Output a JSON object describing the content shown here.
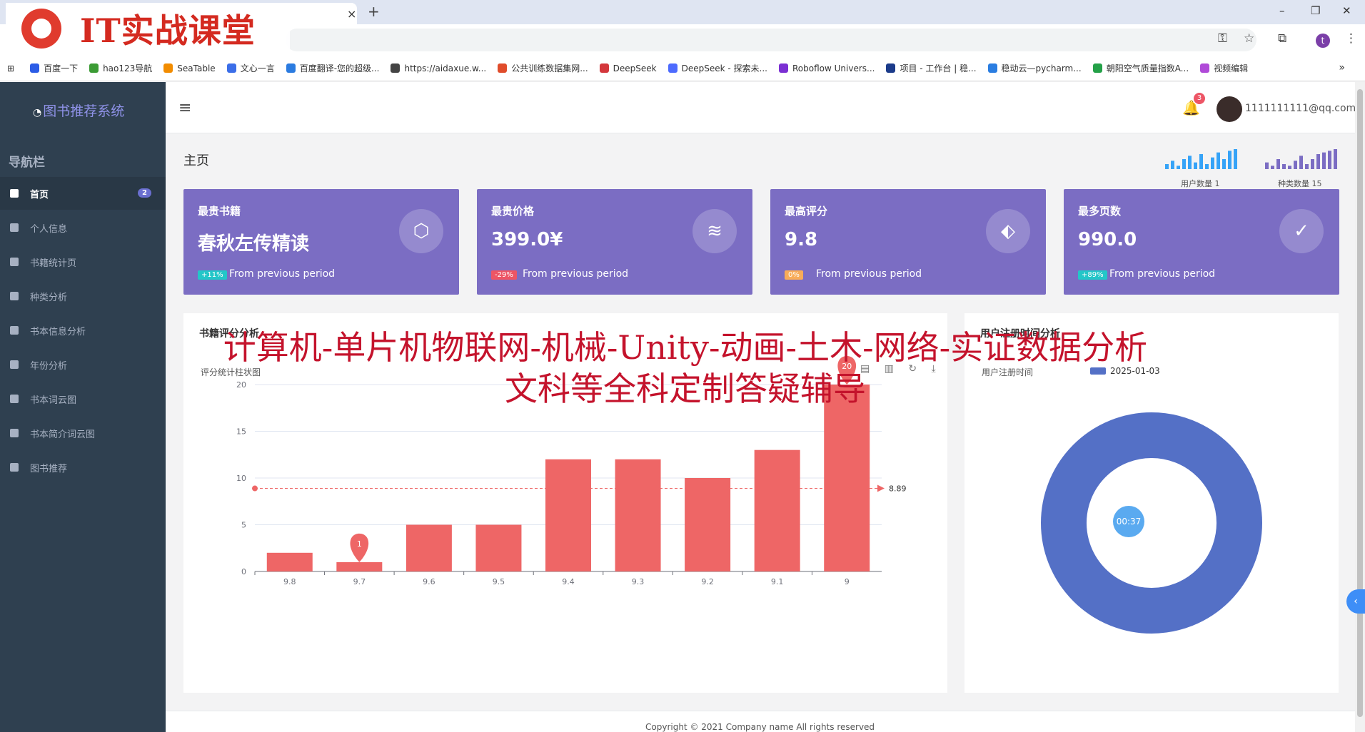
{
  "browser": {
    "tab_close": "×",
    "new_tab": "+",
    "window": {
      "minimize": "–",
      "restore": "❐",
      "close": "✕"
    },
    "profile_initial": "t",
    "bookmarks": [
      {
        "label": "百度一下",
        "color": "#2b5ce6"
      },
      {
        "label": "hao123导航",
        "color": "#3b9b34"
      },
      {
        "label": "SeaTable",
        "color": "#f28c00"
      },
      {
        "label": "文心一言",
        "color": "#3b6ee8"
      },
      {
        "label": "百度翻译-您的超级...",
        "color": "#2b7be0"
      },
      {
        "label": "https://aidaxue.w...",
        "color": "#444444"
      },
      {
        "label": "公共训练数据集网...",
        "color": "#e04c2b"
      },
      {
        "label": "DeepSeek",
        "color": "#d4373c"
      },
      {
        "label": "DeepSeek - 探索未...",
        "color": "#4d6bfe"
      },
      {
        "label": "Roboflow Univers...",
        "color": "#7b2fd3"
      },
      {
        "label": "项目 - 工作台 | 稳...",
        "color": "#1b3b8a"
      },
      {
        "label": "稳动云—pycharm...",
        "color": "#2a7de1"
      },
      {
        "label": "朝阳空气质量指数A...",
        "color": "#24a148"
      },
      {
        "label": "视频编辑",
        "color": "#b04ad8"
      }
    ],
    "bookmarks_more": "»"
  },
  "watermark": {
    "logo_text": "IT实战课堂",
    "banner_line1": "计算机-单片机物联网-机械-Unity-动画-土木-网络-实证数据分析",
    "banner_line2": "文科等全科定制答疑辅导"
  },
  "sidebar": {
    "brand": "图书推荐系统",
    "nav_heading": "导航栏",
    "items": [
      {
        "label": "首页",
        "badge": "2",
        "active": true
      },
      {
        "label": "个人信息"
      },
      {
        "label": "书籍统计页"
      },
      {
        "label": "种类分析"
      },
      {
        "label": "书本信息分析"
      },
      {
        "label": "年份分析"
      },
      {
        "label": "书本词云图"
      },
      {
        "label": "书本简介词云图"
      },
      {
        "label": "图书推荐"
      }
    ]
  },
  "topbar": {
    "menu_icon": "≡",
    "bell_icon": "🔔",
    "notification_count": "3",
    "user_email": "1111111111@qq.com"
  },
  "main": {
    "page_title": "主页",
    "mini_charts": [
      {
        "label": "用户数量 1",
        "color": "#36a3f7",
        "bars": [
          3,
          5,
          2,
          6,
          8,
          4,
          9,
          3,
          7,
          10,
          6,
          11,
          12
        ]
      },
      {
        "label": "种类数量 15",
        "color": "#7b6dc3",
        "bars": [
          4,
          2,
          6,
          3,
          2,
          5,
          8,
          3,
          6,
          9,
          10,
          11,
          12
        ]
      }
    ],
    "stat_cards": [
      {
        "title": "最贵书籍",
        "value": "春秋左传精读",
        "badge": "+11%",
        "badge_color": "#23c6c8",
        "foot": "From previous period",
        "icon": "⬡"
      },
      {
        "title": "最贵价格",
        "value": "399.0¥",
        "badge": "-29%",
        "badge_color": "#ed5565",
        "foot": "From previous period",
        "icon": "≋"
      },
      {
        "title": "最高评分",
        "value": "9.8",
        "badge": "0%",
        "badge_color": "#f8ac59",
        "foot": "From previous period",
        "icon": "⬖"
      },
      {
        "title": "最多页数",
        "value": "990.0",
        "badge": "+89%",
        "badge_color": "#23c6c8",
        "foot": "From previous period",
        "icon": "✓"
      }
    ],
    "rating_panel": {
      "title": "书籍评分分析",
      "subtitle": "评分统计柱状图",
      "toolbox": "▤ ▥ ↻ ⤓"
    },
    "register_panel": {
      "title": "用户注册时间分析",
      "subtitle": "用户注册时间",
      "legend": "2025-01-03",
      "timer": "00:37"
    }
  },
  "chart_data": [
    {
      "type": "bar",
      "title": "评分统计柱状图",
      "categories": [
        "9.8",
        "9.7",
        "9.6",
        "9.5",
        "9.4",
        "9.3",
        "9.2",
        "9.1",
        "9"
      ],
      "values": [
        2,
        1,
        5,
        5,
        12,
        12,
        10,
        13,
        20
      ],
      "ylim": [
        0,
        20
      ],
      "yticks": [
        "0",
        "5",
        "10",
        "15",
        "20"
      ],
      "mark_line": {
        "label": "8.89",
        "value": 8.89
      },
      "mark_points": [
        {
          "category": "9.7",
          "value": 1,
          "label": "1"
        },
        {
          "category": "9",
          "value": 20,
          "label": "20"
        }
      ],
      "color": "#ee6666",
      "grid": true
    },
    {
      "type": "pie",
      "title": "用户注册时间",
      "legend_position": "top",
      "slices": [
        {
          "label": "2025-01-03",
          "value": 1
        }
      ],
      "color": "#5470c6"
    }
  ],
  "footer": {
    "copyright": "Copyright © 2021 Company name All rights reserved"
  }
}
